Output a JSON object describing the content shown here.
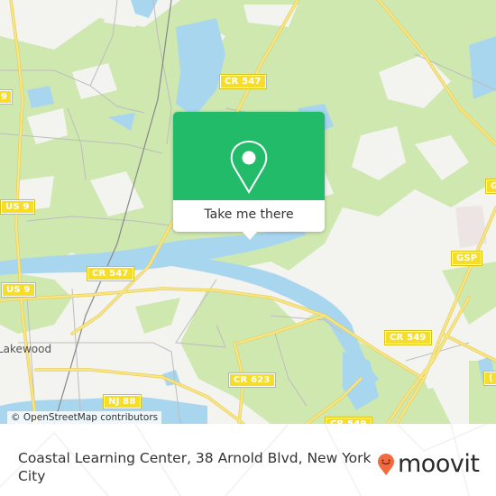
{
  "map": {
    "attribution": "© OpenStreetMap contributors",
    "place_labels": [
      {
        "name": "lakewood",
        "text": "Lakewood"
      }
    ],
    "road_shields": [
      {
        "name": "cr-547-north",
        "text": "CR 547"
      },
      {
        "name": "us-9-upper",
        "text": "US 9"
      },
      {
        "name": "us-9-lower",
        "text": "US 9"
      },
      {
        "name": "cr-547-west",
        "text": "CR 547"
      },
      {
        "name": "gsp-upper",
        "text": "GSP"
      },
      {
        "name": "gsp-lower",
        "text": "GSP"
      },
      {
        "name": "cr-623",
        "text": "CR 623"
      },
      {
        "name": "cr-549-east",
        "text": "CR 549"
      },
      {
        "name": "cr-549-south",
        "text": "CR 549"
      },
      {
        "name": "nj-88",
        "text": "NJ 88"
      },
      {
        "name": "edge-left",
        "text": "9"
      },
      {
        "name": "edge-right",
        "text": "("
      }
    ],
    "colors": {
      "land": "#f3f3f0",
      "park": "#cfe8b0",
      "water": "#a9d6ef",
      "major_road": "#f6e27a",
      "minor_road": "#bdbdbd",
      "shield": "#f5dd2a"
    }
  },
  "popup": {
    "button_label": "Take me there",
    "icon": "map-pin-icon",
    "color": "#22bb6a"
  },
  "footer": {
    "title": "Coastal Learning Center, 38 Arnold Blvd, New York City",
    "brand": "moovit",
    "brand_icon": "moovit-smiley-pin-icon",
    "brand_color": "#f26a3d"
  }
}
